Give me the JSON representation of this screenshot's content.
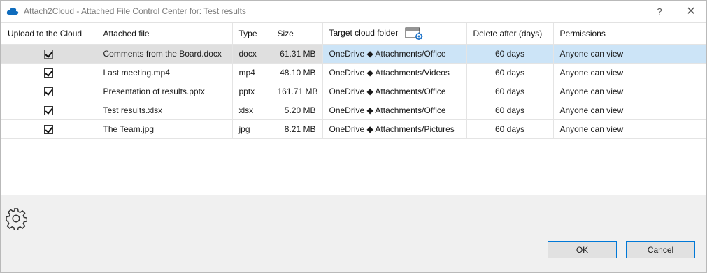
{
  "window": {
    "title": "Attach2Cloud - Attached File Control Center for: Test results",
    "help_label": "?",
    "close_label": "✕"
  },
  "columns": [
    "Upload to the Cloud",
    "Attached file",
    "Type",
    "Size",
    "Target cloud folder",
    "Delete after (days)",
    "Permissions"
  ],
  "rows": [
    {
      "checked": true,
      "file": "Comments from the Board.docx",
      "type": "docx",
      "size": "61.31 MB",
      "folder": "OneDrive ◆ Attachments/Office",
      "delete": "60 days",
      "permissions": "Anyone can view"
    },
    {
      "checked": true,
      "file": "Last meeting.mp4",
      "type": "mp4",
      "size": "48.10 MB",
      "folder": "OneDrive ◆ Attachments/Videos",
      "delete": "60 days",
      "permissions": "Anyone can view"
    },
    {
      "checked": true,
      "file": "Presentation of results.pptx",
      "type": "pptx",
      "size": "161.71 MB",
      "folder": "OneDrive ◆ Attachments/Office",
      "delete": "60 days",
      "permissions": "Anyone can view"
    },
    {
      "checked": true,
      "file": "Test results.xlsx",
      "type": "xlsx",
      "size": "5.20 MB",
      "folder": "OneDrive ◆ Attachments/Office",
      "delete": "60 days",
      "permissions": "Anyone can view"
    },
    {
      "checked": true,
      "file": "The Team.jpg",
      "type": "jpg",
      "size": "8.21 MB",
      "folder": "OneDrive ◆ Attachments/Pictures",
      "delete": "60 days",
      "permissions": "Anyone can view"
    }
  ],
  "buttons": {
    "ok": "OK",
    "cancel": "Cancel"
  },
  "icons": {
    "app": "cloud-icon",
    "folder": "folder-settings-icon",
    "settings": "gear-icon"
  },
  "colors": {
    "selection": "#cce4f7",
    "accent": "#0078d7",
    "cloud": "#0f6cbd"
  }
}
